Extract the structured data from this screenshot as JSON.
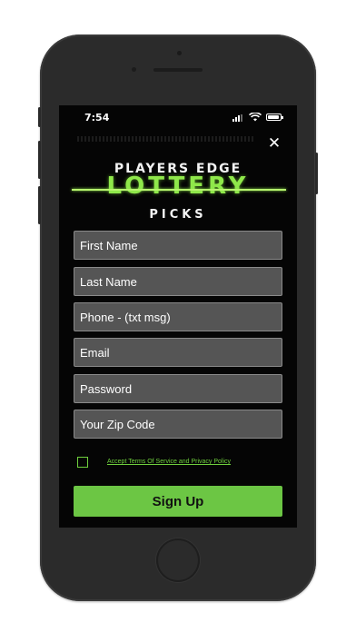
{
  "status_bar": {
    "time": "7:54"
  },
  "logo": {
    "line1": "PLAYERS EDGE",
    "line2": "LOTTERY",
    "line3": "PICKS"
  },
  "form": {
    "first_name_placeholder": "First Name",
    "last_name_placeholder": "Last Name",
    "phone_placeholder": "Phone - (txt msg)",
    "email_placeholder": "Email",
    "password_placeholder": "Password",
    "zip_placeholder": "Your Zip Code",
    "terms_label": "Accept Terms Of Service and Privacy Policy",
    "terms_checked": false,
    "signup_label": "Sign Up"
  },
  "icons": {
    "close": "close-icon",
    "signal": "cellular-signal-icon",
    "wifi": "wifi-icon",
    "battery": "battery-icon"
  },
  "colors": {
    "accent": "#6cc644",
    "logo_green": "#8fe84a",
    "field_bg": "#555555",
    "screen_bg": "#050505"
  }
}
